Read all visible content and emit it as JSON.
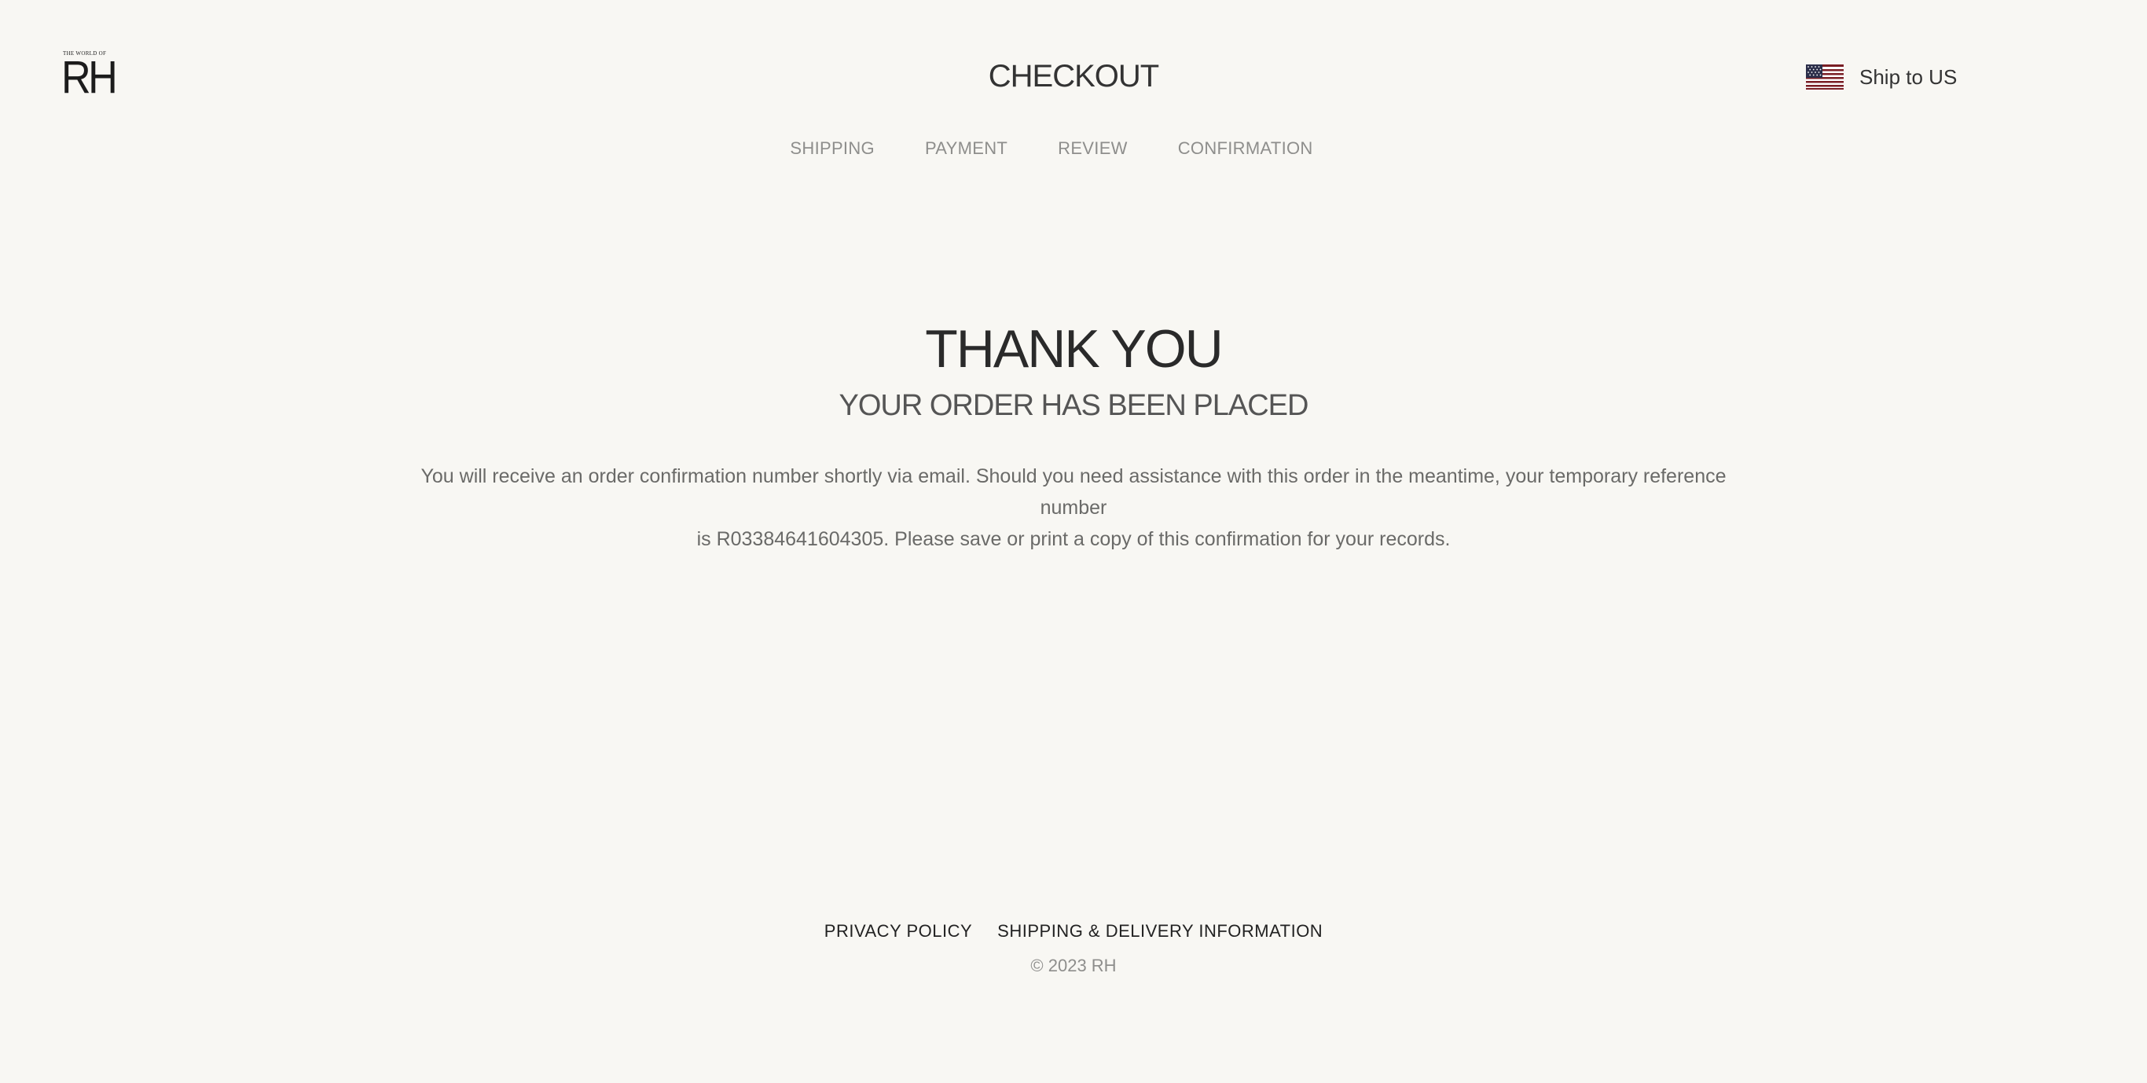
{
  "header": {
    "logo": {
      "small_text": "THE WORLD OF",
      "big_text": "RH"
    },
    "title": "CHECKOUT",
    "ship_to": {
      "label": "Ship to US",
      "flag_icon": "us-flag-icon"
    }
  },
  "steps": [
    {
      "label": "SHIPPING"
    },
    {
      "label": "PAYMENT"
    },
    {
      "label": "REVIEW"
    },
    {
      "label": "CONFIRMATION"
    }
  ],
  "confirmation": {
    "heading": "THANK YOU",
    "subheading": "YOUR ORDER HAS BEEN PLACED",
    "message_line1": "You will receive an order confirmation number shortly via email. Should you need assistance with this order in the meantime, your temporary reference number",
    "message_line2": "is R03384641604305. Please save or print a copy of this confirmation for your records."
  },
  "footer": {
    "links": [
      {
        "label": "PRIVACY POLICY"
      },
      {
        "label": "SHIPPING & DELIVERY INFORMATION"
      }
    ],
    "copyright": "© 2023 RH"
  },
  "colors": {
    "background": "#f8f7f3",
    "text_dark": "#222222",
    "text_muted": "#8e8e8c"
  }
}
